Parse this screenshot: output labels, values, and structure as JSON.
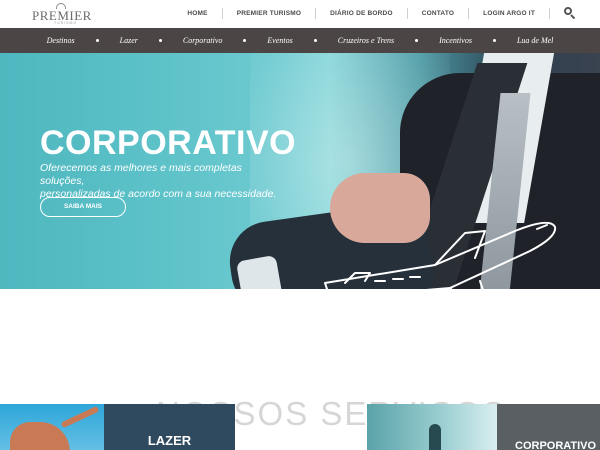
{
  "brand": {
    "name": "PREMIER",
    "subtitle": "TURISMO"
  },
  "topnav": {
    "items": [
      "HOME",
      "PREMIER TURISMO",
      "DIÁRIO DE BORDO",
      "CONTATO",
      "LOGIN ARGO IT"
    ],
    "search_icon": "search-icon"
  },
  "categories": [
    "Destinos",
    "Lazer",
    "Corporativo",
    "Eventos",
    "Cruzeiros e Trens",
    "Incentivos",
    "Lua de Mel"
  ],
  "hero": {
    "title": "CORPORATIVO",
    "text_line1": "Oferecemos as melhores e mais completas soluções,",
    "text_line2": "personalizadas de acordo com a sua necessidade.",
    "button": "SAIBA MAIS",
    "slides": 2,
    "active_slide": 1
  },
  "services": {
    "title": "NOSSOS SERVIÇOS",
    "tiles": [
      "",
      "LAZER",
      "",
      "CORPORATIVO"
    ]
  },
  "colors": {
    "catbar": "#4b4645",
    "hero_teal": "#5cc1c8",
    "text_dark": "#4a4a4a"
  }
}
